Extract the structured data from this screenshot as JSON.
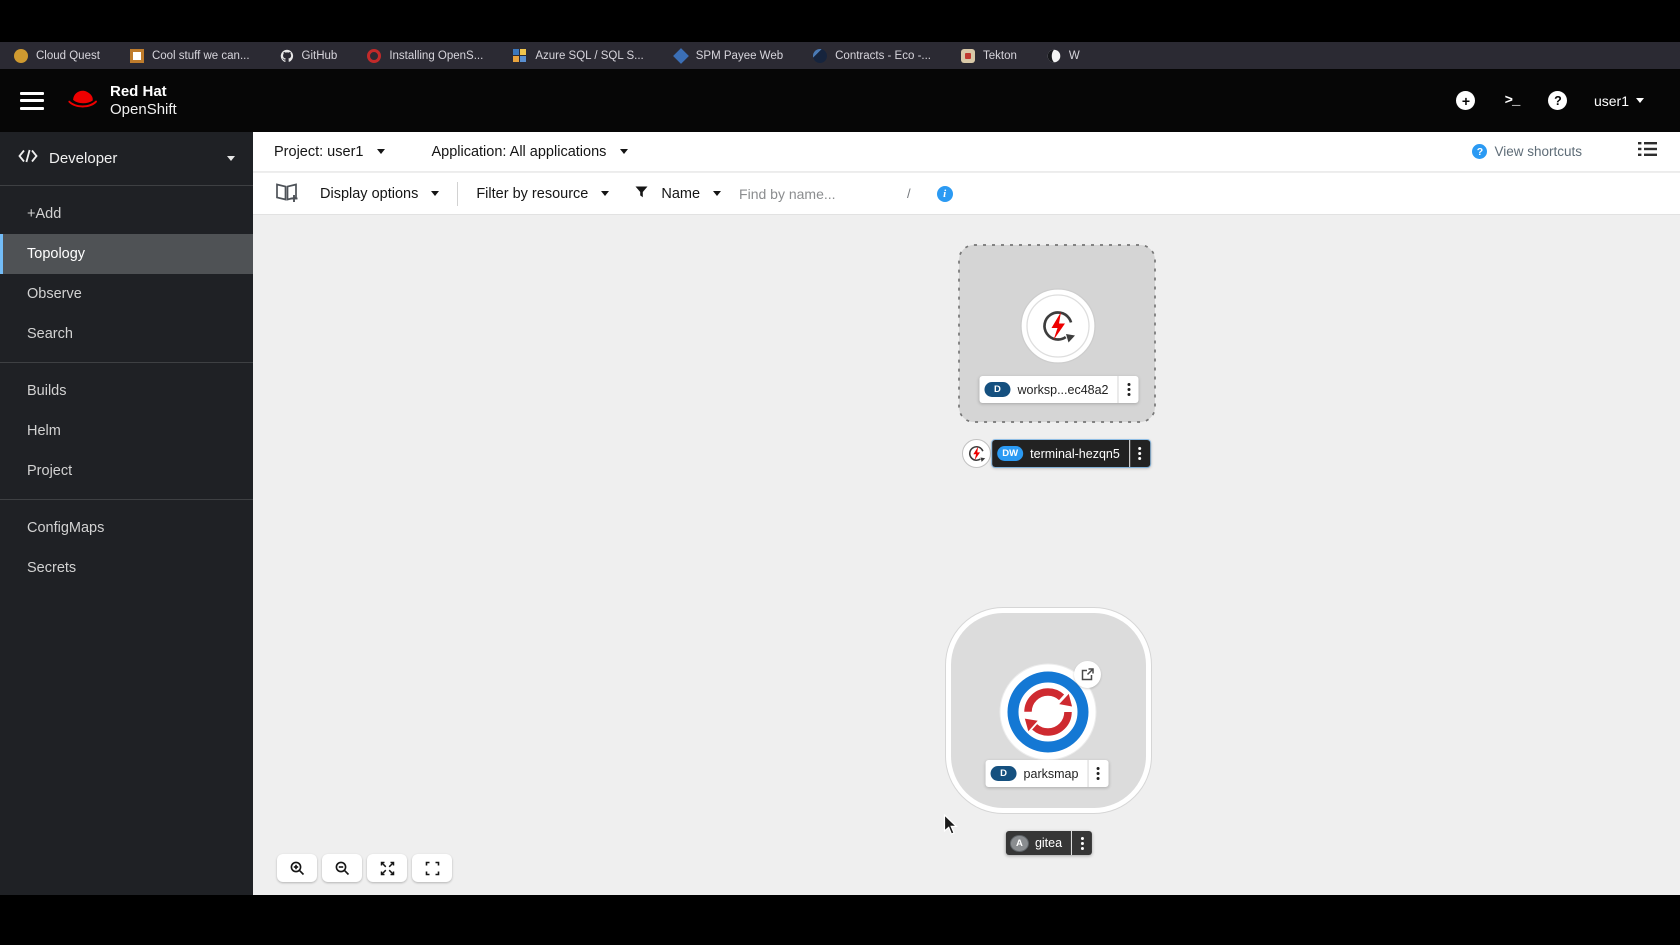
{
  "bookmarks_bar": {
    "items": [
      {
        "label": "Cloud Quest"
      },
      {
        "label": "Cool stuff we can..."
      },
      {
        "label": "GitHub"
      },
      {
        "label": "Installing OpenS..."
      },
      {
        "label": "Azure SQL / SQL S..."
      },
      {
        "label": "SPM Payee Web"
      },
      {
        "label": "Contracts - Eco -..."
      },
      {
        "label": "Tekton"
      },
      {
        "label": "W"
      }
    ]
  },
  "masthead": {
    "brand_line1": "Red Hat",
    "brand_line2": "OpenShift",
    "user_menu": "user1"
  },
  "sidebar": {
    "perspective": "Developer",
    "group1": [
      "+Add",
      "Topology",
      "Observe",
      "Search"
    ],
    "group2": [
      "Builds",
      "Helm",
      "Project"
    ],
    "group3": [
      "ConfigMaps",
      "Secrets"
    ],
    "selected_item": "Topology"
  },
  "context_bar": {
    "project": "Project: user1",
    "application": "Application: All applications",
    "view_shortcuts": "View shortcuts"
  },
  "toolbar": {
    "display_options": "Display options",
    "filter_by_resource": "Filter by resource",
    "name_filter": "Name",
    "find_placeholder": "Find by name...",
    "shortcut_hint": "/"
  },
  "topology": {
    "workspace": {
      "badge": "D",
      "label": "worksp...ec48a2"
    },
    "terminal": {
      "badge": "DW",
      "label": "terminal-hezqn5"
    },
    "parksmap": {
      "badge": "D",
      "label": "parksmap"
    },
    "gitea": {
      "badge": "A",
      "label": "gitea"
    }
  },
  "colors": {
    "brand_red": "#ee0000",
    "accent_blue": "#2b9af3",
    "badge_navy": "#15507f",
    "nav_selected_border": "#73bcf7",
    "canvas_bg": "#efefef"
  }
}
